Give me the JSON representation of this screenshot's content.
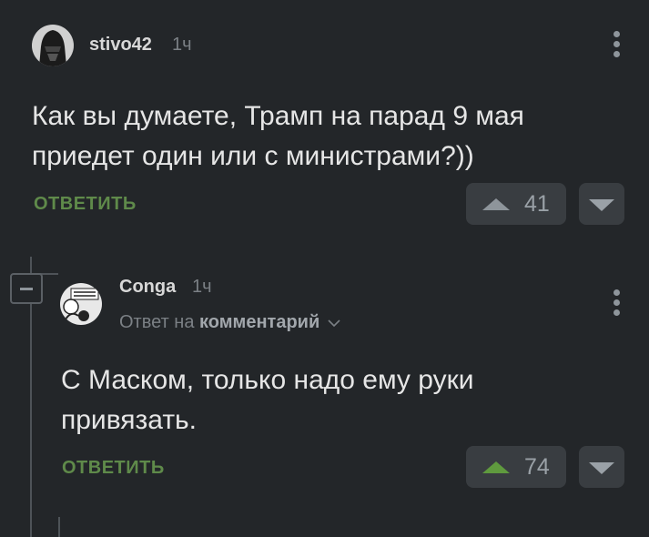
{
  "comments": [
    {
      "username": "stivo42",
      "time": "1ч",
      "text": "Как вы думаете, Трамп на парад 9 мая приедет один или с министрами?))",
      "reply_label": "ОТВЕТИТЬ",
      "rating": "41"
    },
    {
      "username": "Conga",
      "time": "1ч",
      "reply_to_prefix": "Ответ на",
      "reply_to_link": "комментарий",
      "text": "С Маском, только надо ему руки привязать.",
      "reply_label": "ОТВЕТИТЬ",
      "rating": "74"
    }
  ],
  "colors": {
    "background": "#232629",
    "accent_green": "#5f8a4a",
    "vote_box": "#393d41"
  }
}
